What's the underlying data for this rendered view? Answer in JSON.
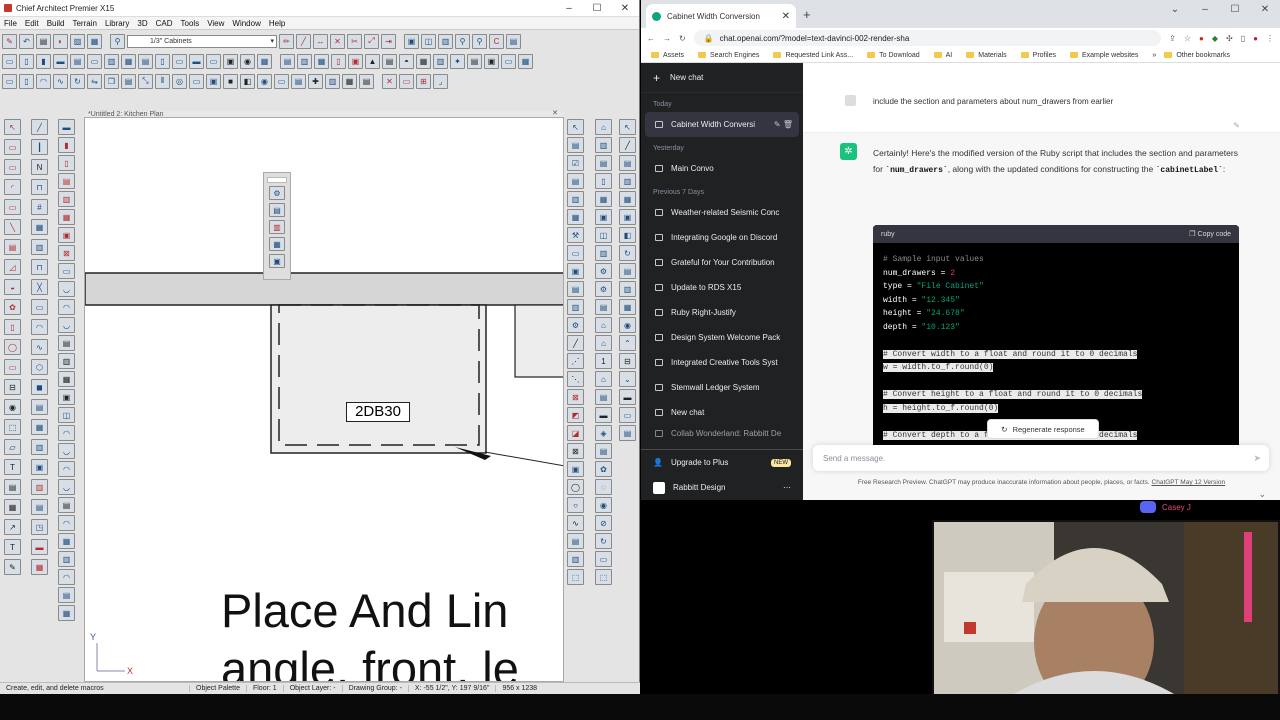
{
  "chief": {
    "title": "Chief Architect Premier X15",
    "menu": [
      "File",
      "Edit",
      "Build",
      "Terrain",
      "Library",
      "3D",
      "CAD",
      "Tools",
      "View",
      "Window",
      "Help"
    ],
    "cabinet_select": "1/3\" Cabinets",
    "doc_tab": "*Untitled 2: Kitchen Plan",
    "cabinet_label": "2DB30",
    "plan_text_1": "Place And Lin",
    "plan_text_2": "angle, front, le",
    "axis_y": "Y",
    "axis_x": "X",
    "status": {
      "hint": "Create, edit, and delete macros",
      "palette": "Object Palette",
      "floor": "Floor: 1",
      "layer": "Object Layer: -",
      "group": "Drawing Group: -",
      "coords": "X: -55 1/2\", Y: 197 9/16\"",
      "size": "956 x 1238"
    }
  },
  "browser": {
    "tab_title": "Cabinet Width Conversion",
    "url": "chat.openai.com/?model=text-davinci-002-render-sha",
    "bookmarks": [
      "Assets",
      "Search Engines",
      "Requested Link Ass...",
      "To Download",
      "AI",
      "Materials",
      "Profiles",
      "Example websites"
    ],
    "other_bookmarks": "Other bookmarks"
  },
  "sidebar": {
    "new_chat": "New chat",
    "today_label": "Today",
    "today": [
      "Cabinet Width Conversi"
    ],
    "yesterday_label": "Yesterday",
    "yesterday": [
      "Main Convo"
    ],
    "prev7_label": "Previous 7 Days",
    "prev7": [
      "Weather-related Seismic Conc",
      "Integrating Google on Discord",
      "Grateful for Your Contribution",
      "Update to RDS X15",
      "Ruby Right-Justify",
      "Design System Welcome Pack",
      "Integrated Creative Tools Syst",
      "Stemwall Ledger System",
      "New chat",
      "Collab Wonderland: Rabbitt De"
    ],
    "upgrade": "Upgrade to Plus",
    "new_badge": "NEW",
    "account": "Rabbitt Design"
  },
  "chat": {
    "user_message": "include the section and parameters about num_drawers from earlier",
    "reply_1": "Certainly! Here's the modified version of the Ruby script that includes the section and parameters for ",
    "reply_code_1": "`num_drawers`",
    "reply_2": ", along with the updated conditions for constructing the ",
    "reply_code_2": "`cabinetLabel`",
    "reply_3": ":",
    "code_lang": "ruby",
    "copy_code": "Copy code",
    "code_comment": "# Sample input values",
    "code_lines": [
      {
        "var": "num_drawers",
        "val": "2",
        "kind": "num"
      },
      {
        "var": "type",
        "val": "\"File Cabinet\"",
        "kind": "str"
      },
      {
        "var": "width",
        "val": "\"12.345\"",
        "kind": "str"
      },
      {
        "var": "height",
        "val": "\"24.678\"",
        "kind": "str"
      },
      {
        "var": "depth",
        "val": "\"10.123\"",
        "kind": "str"
      }
    ],
    "code_selected": [
      "# Convert width to a float and round it to 0 decimals",
      "w = width.to_f.round(0)",
      "",
      "# Convert height to a float and round it to 0 decimals",
      "h = height.to_f.round(0)",
      "",
      "# Convert depth to a float and round it to 0 decimals"
    ],
    "regenerate": "Regenerate response",
    "placeholder": "Send a message.",
    "disclaimer_a": "Free Research Preview. ChatGPT may produce inaccurate information about people, places, or facts. ",
    "disclaimer_link": "ChatGPT May 12 Version"
  },
  "overlay": {
    "caption": "Casey J"
  }
}
